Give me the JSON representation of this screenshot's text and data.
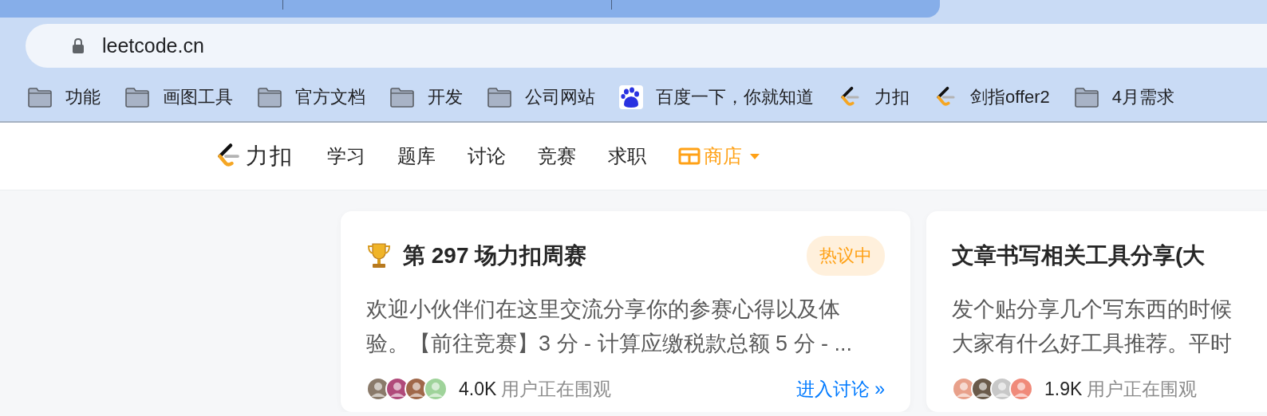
{
  "browser": {
    "address": "leetcode.cn",
    "bookmarks": [
      {
        "kind": "folder",
        "label": "功能"
      },
      {
        "kind": "folder",
        "label": "画图工具"
      },
      {
        "kind": "folder",
        "label": "官方文档"
      },
      {
        "kind": "folder",
        "label": "开发"
      },
      {
        "kind": "folder",
        "label": "公司网站"
      },
      {
        "kind": "baidu",
        "label": "百度一下，你就知道"
      },
      {
        "kind": "leetcode",
        "label": "力扣"
      },
      {
        "kind": "leetcode",
        "label": "剑指offer2"
      },
      {
        "kind": "folder",
        "label": "4月需求"
      }
    ]
  },
  "site_nav": {
    "logo": "力扣",
    "items": [
      {
        "kind": "link",
        "label": "学习"
      },
      {
        "kind": "link",
        "label": "题库"
      },
      {
        "kind": "link",
        "label": "讨论"
      },
      {
        "kind": "link",
        "label": "竞赛"
      },
      {
        "kind": "link",
        "label": "求职"
      },
      {
        "kind": "store",
        "label": "商店"
      }
    ]
  },
  "cards": [
    {
      "trophy": true,
      "title": "第 297 场力扣周赛",
      "badge": "热议中",
      "description_lines": [
        "欢迎小伙伴们在这里交流分享你的参赛心得以及体",
        "验。【前往竞赛】3 分 - 计算应缴税款总额 5 分 - ..."
      ],
      "viewers": "4.0K",
      "viewers_label": "用户正在围观",
      "link": "进入讨论 »"
    },
    {
      "trophy": false,
      "title": "文章书写相关工具分享(大",
      "description_lines": [
        "发个贴分享几个写东西的时候",
        "大家有什么好工具推荐。平时"
      ],
      "viewers": "1.9K",
      "viewers_label": "用户正在围观"
    }
  ]
}
